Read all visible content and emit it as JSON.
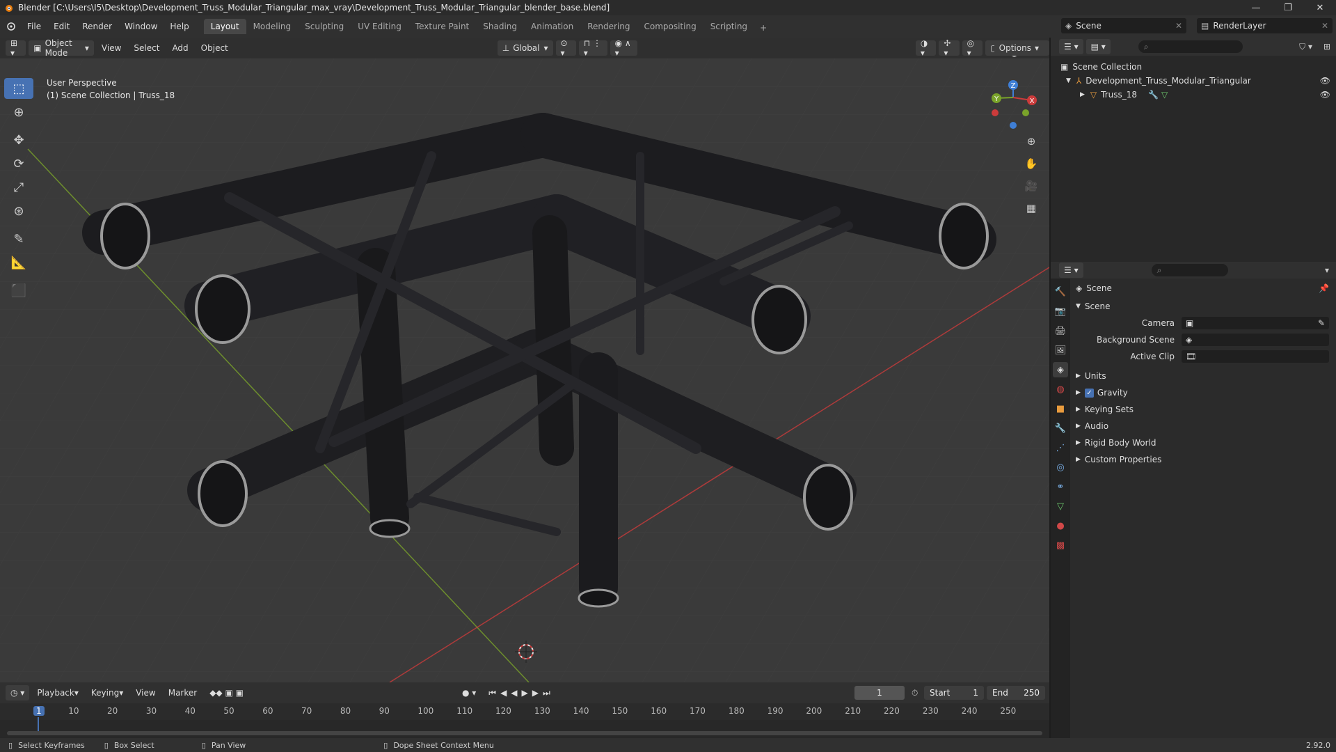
{
  "window": {
    "title": "Blender [C:\\Users\\I5\\Desktop\\Development_Truss_Modular_Triangular_max_vray\\Development_Truss_Modular_Triangular_blender_base.blend]",
    "controls": [
      "—",
      "❐",
      "✕"
    ]
  },
  "menu": [
    "File",
    "Edit",
    "Render",
    "Window",
    "Help"
  ],
  "workspaces": [
    {
      "label": "Layout",
      "active": true
    },
    {
      "label": "Modeling"
    },
    {
      "label": "Sculpting"
    },
    {
      "label": "UV Editing"
    },
    {
      "label": "Texture Paint"
    },
    {
      "label": "Shading"
    },
    {
      "label": "Animation"
    },
    {
      "label": "Rendering"
    },
    {
      "label": "Compositing"
    },
    {
      "label": "Scripting"
    }
  ],
  "scene_selector": "Scene",
  "render_layer": "RenderLayer",
  "viewport_header": {
    "mode": "Object Mode",
    "menus": [
      "View",
      "Select",
      "Add",
      "Object"
    ],
    "transform_orientation": "Global",
    "options": "Options"
  },
  "viewport": {
    "perspective": "User Perspective",
    "collection_info": "(1) Scene Collection | Truss_18",
    "gizmo_axes": {
      "x": "X",
      "y": "Y",
      "z": "Z"
    }
  },
  "outliner": {
    "root": "Scene Collection",
    "items": [
      {
        "label": "Development_Truss_Modular_Triangular",
        "level": 1
      },
      {
        "label": "Truss_18",
        "level": 2
      }
    ]
  },
  "properties": {
    "header": "Scene",
    "section": "Scene",
    "fields": [
      {
        "label": "Camera"
      },
      {
        "label": "Background Scene"
      },
      {
        "label": "Active Clip"
      }
    ],
    "panels": [
      "Units",
      "Gravity",
      "Keying Sets",
      "Audio",
      "Rigid Body World",
      "Custom Properties"
    ],
    "gravity_checked": true
  },
  "timeline": {
    "menus": [
      "Playback",
      "Keying",
      "View",
      "Marker"
    ],
    "current_frame": "1",
    "start_label": "Start",
    "start": "1",
    "end_label": "End",
    "end": "250",
    "ticks": [
      "1",
      "10",
      "20",
      "30",
      "40",
      "50",
      "60",
      "70",
      "80",
      "90",
      "100",
      "110",
      "120",
      "130",
      "140",
      "150",
      "160",
      "170",
      "180",
      "190",
      "200",
      "210",
      "220",
      "230",
      "240",
      "250"
    ]
  },
  "statusbar": {
    "items": [
      "Select Keyframes",
      "Box Select",
      "Pan View",
      "Dope Sheet Context Menu"
    ],
    "version": "2.92.0"
  },
  "colors": {
    "accent": "#4772b3",
    "x_axis": "#cc3b3b",
    "y_axis": "#7aa32a",
    "z_axis": "#3f7fd6",
    "viewport_bg": "#3a3a3a"
  }
}
